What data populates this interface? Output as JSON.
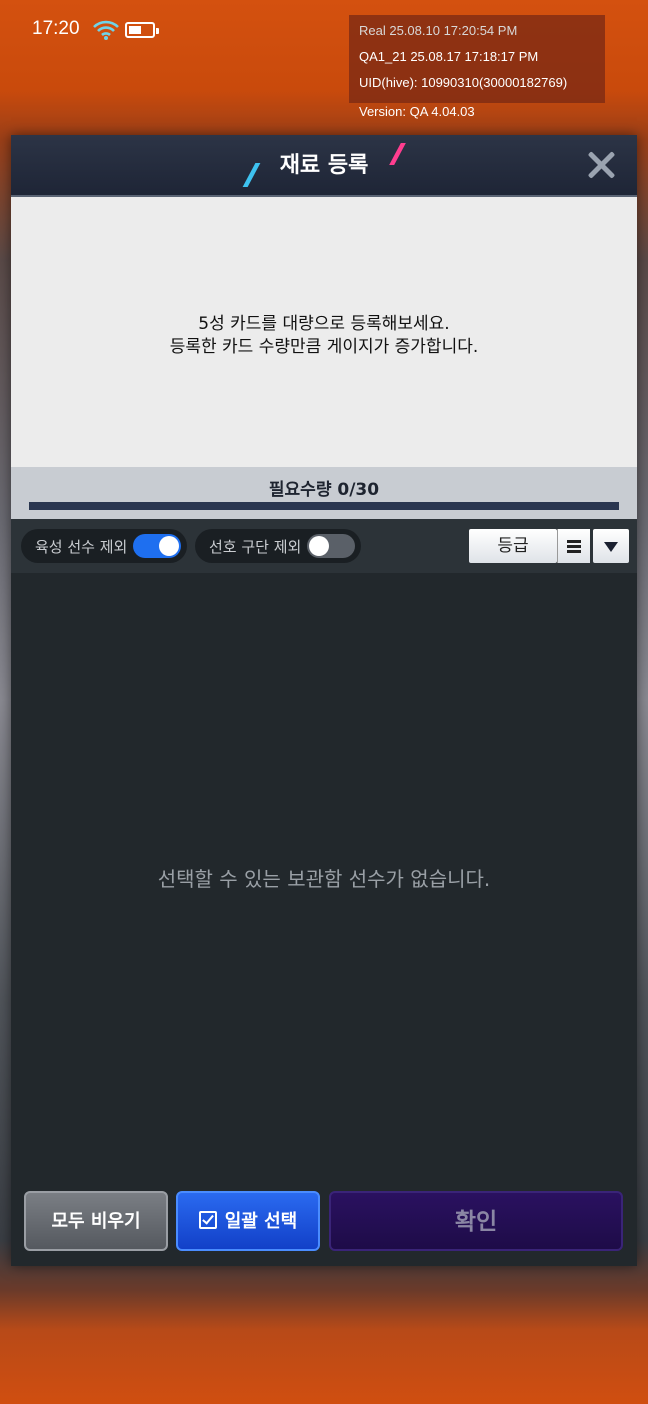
{
  "status_bar": {
    "time": "17:20",
    "wifi_icon": "wifi-icon",
    "battery_icon": "battery-icon",
    "battery_level": 0.55
  },
  "debug_overlay": {
    "line1": "Real    25.08.10 17:20:54 PM",
    "line2": "QA1_21  25.08.17 17:18:17 PM",
    "line3": "UID(hive): 10990310(30000182769)",
    "version": "Version: QA 4.04.03"
  },
  "dialog": {
    "title": "재료 등록",
    "close_icon": "close-icon",
    "description_line1": "5성 카드를 대량으로 등록해보세요.",
    "description_line2": "등록한 카드 수량만큼 게이지가 증가합니다.",
    "required_label": "필요수량  0/30",
    "progress": 0,
    "filters": {
      "exclude_training": {
        "label": "육성 선수 제외",
        "on": true
      },
      "exclude_favorite": {
        "label": "선호 구단 제외",
        "on": false
      },
      "sort_label": "등급",
      "sort_menu_icon": "list-icon",
      "sort_dropdown_icon": "caret-down-icon"
    },
    "empty_message": "선택할 수 있는 보관함 선수가 없습니다.",
    "buttons": {
      "clear": "모두 비우기",
      "bulk_select": "일괄 선택",
      "bulk_select_icon": "checkbox-icon",
      "confirm": "확인"
    }
  },
  "colors": {
    "toggle_on": "#1e6ff0",
    "toggle_off": "#5a6068",
    "progress_fill": "#4a8af0",
    "accent_blue": "#3ec2f0",
    "accent_pink": "#ff3d8f"
  }
}
